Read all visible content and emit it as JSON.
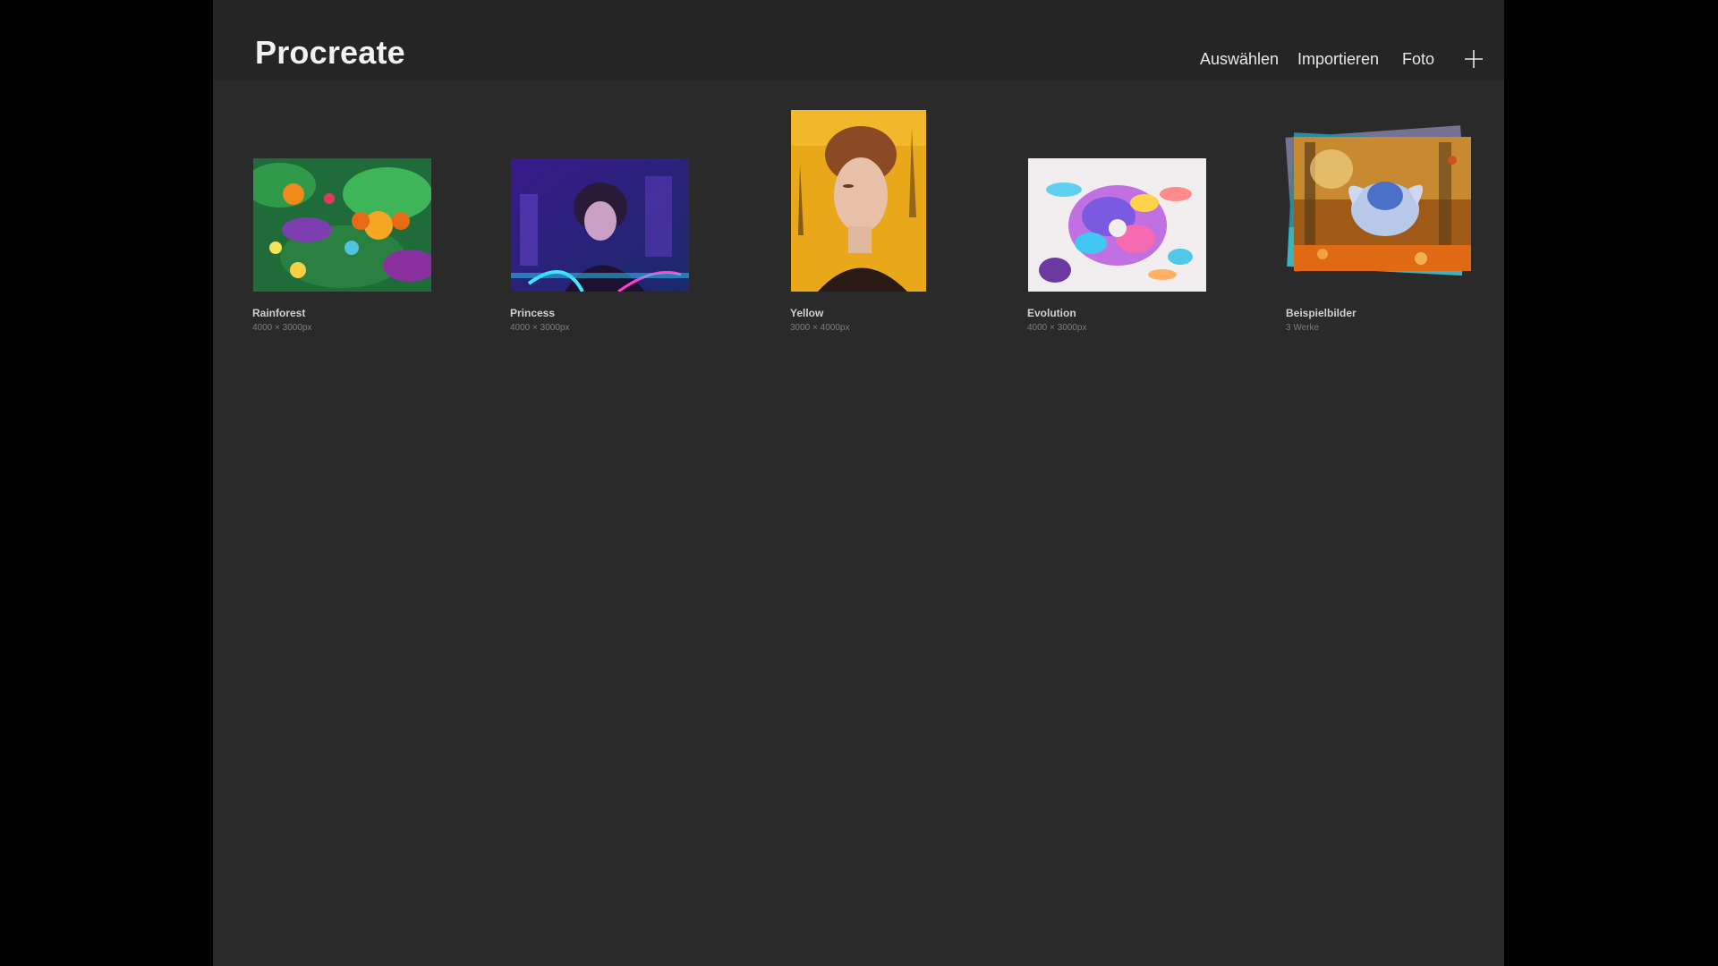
{
  "header": {
    "app_title": "Procreate",
    "actions": {
      "select": "Auswählen",
      "import": "Importieren",
      "photo": "Foto"
    },
    "new_icon": "plus-icon"
  },
  "gallery": {
    "items": [
      {
        "title": "Rainforest",
        "subtitle": "4000 × 3000px"
      },
      {
        "title": "Princess",
        "subtitle": "4000 × 3000px"
      },
      {
        "title": "Yellow",
        "subtitle": "3000 × 4000px"
      },
      {
        "title": "Evolution",
        "subtitle": "4000 × 3000px"
      },
      {
        "title": "Beispielbilder",
        "subtitle": "3 Werke"
      }
    ]
  },
  "colors": {
    "background": "#2a2a2a",
    "header_background": "#252525",
    "letterbox": "#000000",
    "text_primary": "#f2f2f2"
  }
}
